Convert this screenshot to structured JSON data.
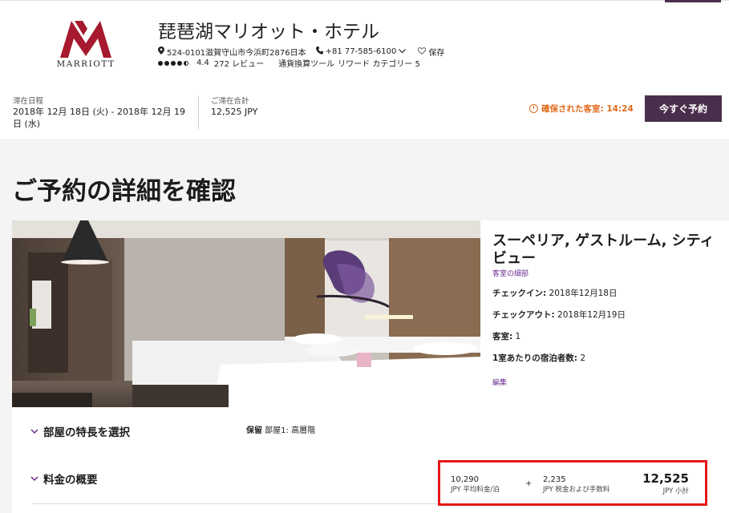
{
  "brand": {
    "logo_text": "MARRIOTT",
    "color": "#a6192e"
  },
  "hotel": {
    "name": "琵琶湖マリオット・ホテル",
    "address": "524-0101滋賀守山市今浜町2876日本",
    "phone": "+81 77-585-6100",
    "save_label": "保存",
    "rating": "4.4",
    "reviews": "272 レビュー",
    "currency_link": "通貨換算ツール",
    "category": "リワード カテゴリー 5"
  },
  "stay": {
    "dates_label": "滞在日程",
    "dates_line1": "2018年 12月 18日 (火) - 2018年 12月 19",
    "dates_line2": "日 (水)",
    "total_label": "ご滞在合計",
    "total_value": "12,525 JPY",
    "timer_label": "確保された客室: 14:24",
    "book_button": "今すぐ予約",
    "accent_color": "#4a2f4c",
    "timer_color": "#e06a1b"
  },
  "page": {
    "title": "ご予約の詳細を確認"
  },
  "room": {
    "title": "スーペリア, ゲストルーム, シティビュー",
    "details_link": "客室の細部",
    "checkin_label": "チェックイン:",
    "checkin_value": " 2018年12月18日",
    "checkout_label": "チェックアウト:",
    "checkout_value": " 2018年12月19日",
    "rooms_label": "客室:",
    "rooms_value": " 1",
    "guests_label": "1室あたりの宿泊者数:",
    "guests_value": " 2",
    "edit_link": "編集"
  },
  "sections": {
    "features_label": "部屋の特長を選択",
    "reserve_label": "保留",
    "reserve_value": " 部屋1: 高層階",
    "rates_label": "料金の概要"
  },
  "rates": {
    "avg_value": "10,290",
    "avg_label": "JPY 平均料金/泊",
    "plus": "+",
    "tax_value": "2,235",
    "tax_label": "JPY 税金および手数料",
    "total_value": "12,525",
    "total_label": "JPY 小計",
    "highlight_color": "#e41818"
  },
  "icons": [
    "location-pin-icon",
    "phone-icon",
    "chevron-down-icon",
    "heart-icon",
    "clock-icon",
    "chevron-right-icon"
  ]
}
